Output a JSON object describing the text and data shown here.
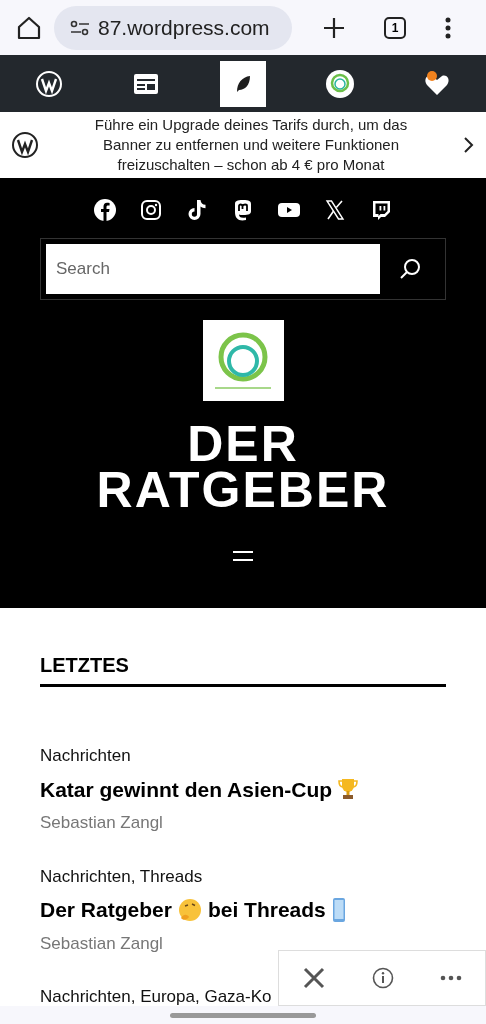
{
  "browser": {
    "url": "87.wordpress.com",
    "tab_count": "1"
  },
  "admin_bar": {
    "items": [
      {
        "kind": "wordpress",
        "selected": false
      },
      {
        "kind": "reader",
        "selected": false
      },
      {
        "kind": "editor",
        "selected": true
      },
      {
        "kind": "site",
        "selected": false
      },
      {
        "kind": "notifications",
        "selected": false
      }
    ]
  },
  "banner": {
    "lines": [
      "Führe ein Upgrade deines Tarifs durch, um das",
      "Banner zu entfernen und weitere Funktionen",
      "freizuschalten – schon ab 4 € pro Monat"
    ]
  },
  "social": [
    {
      "kind": "facebook"
    },
    {
      "kind": "instagram"
    },
    {
      "kind": "tiktok"
    },
    {
      "kind": "mastodon"
    },
    {
      "kind": "youtube"
    },
    {
      "kind": "x"
    },
    {
      "kind": "twitch"
    }
  ],
  "search": {
    "placeholder": "Search"
  },
  "site": {
    "title_lines": [
      "DER",
      "RATGEBER"
    ]
  },
  "section": {
    "heading": "LETZTES"
  },
  "posts": [
    {
      "categories": "Nachrichten",
      "title": [
        {
          "kind": "text",
          "text": "Katar gewinnt den Asien-Cup"
        },
        {
          "kind": "trophy"
        }
      ],
      "author": "Sebastian Zangl"
    },
    {
      "categories": "Nachrichten, Threads",
      "title": [
        {
          "kind": "text",
          "text": "Der Ratgeber"
        },
        {
          "kind": "thinking"
        },
        {
          "kind": "text",
          "text": "bei Threads"
        },
        {
          "kind": "phone"
        }
      ],
      "author": "Sebastian Zangl"
    },
    {
      "categories": "Nachrichten, Europa, Gaza-Ko"
    }
  ]
}
